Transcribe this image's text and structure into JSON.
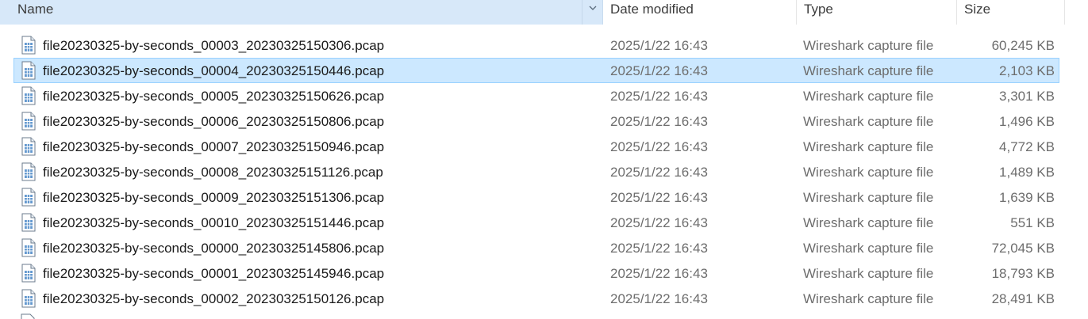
{
  "columns": {
    "name": "Name",
    "date": "Date modified",
    "type": "Type",
    "size": "Size"
  },
  "icons": {
    "file": "document-icon",
    "sort": "chevron-down-icon"
  },
  "colors": {
    "selection": "#cce8ff",
    "selection_border": "#99d1ff",
    "header_active": "#d7e8f9"
  },
  "files": [
    {
      "name": "file20230325-by-seconds_00003_20230325150306.pcap",
      "date": "2025/1/22 16:43",
      "type": "Wireshark capture file",
      "size": "60,245 KB",
      "selected": false
    },
    {
      "name": "file20230325-by-seconds_00004_20230325150446.pcap",
      "date": "2025/1/22 16:43",
      "type": "Wireshark capture file",
      "size": "2,103 KB",
      "selected": true
    },
    {
      "name": "file20230325-by-seconds_00005_20230325150626.pcap",
      "date": "2025/1/22 16:43",
      "type": "Wireshark capture file",
      "size": "3,301 KB",
      "selected": false
    },
    {
      "name": "file20230325-by-seconds_00006_20230325150806.pcap",
      "date": "2025/1/22 16:43",
      "type": "Wireshark capture file",
      "size": "1,496 KB",
      "selected": false
    },
    {
      "name": "file20230325-by-seconds_00007_20230325150946.pcap",
      "date": "2025/1/22 16:43",
      "type": "Wireshark capture file",
      "size": "4,772 KB",
      "selected": false
    },
    {
      "name": "file20230325-by-seconds_00008_20230325151126.pcap",
      "date": "2025/1/22 16:43",
      "type": "Wireshark capture file",
      "size": "1,489 KB",
      "selected": false
    },
    {
      "name": "file20230325-by-seconds_00009_20230325151306.pcap",
      "date": "2025/1/22 16:43",
      "type": "Wireshark capture file",
      "size": "1,639 KB",
      "selected": false
    },
    {
      "name": "file20230325-by-seconds_00010_20230325151446.pcap",
      "date": "2025/1/22 16:43",
      "type": "Wireshark capture file",
      "size": "551 KB",
      "selected": false
    },
    {
      "name": "file20230325-by-seconds_00000_20230325145806.pcap",
      "date": "2025/1/22 16:43",
      "type": "Wireshark capture file",
      "size": "72,045 KB",
      "selected": false
    },
    {
      "name": "file20230325-by-seconds_00001_20230325145946.pcap",
      "date": "2025/1/22 16:43",
      "type": "Wireshark capture file",
      "size": "18,793 KB",
      "selected": false
    },
    {
      "name": "file20230325-by-seconds_00002_20230325150126.pcap",
      "date": "2025/1/22 16:43",
      "type": "Wireshark capture file",
      "size": "28,491 KB",
      "selected": false
    }
  ]
}
